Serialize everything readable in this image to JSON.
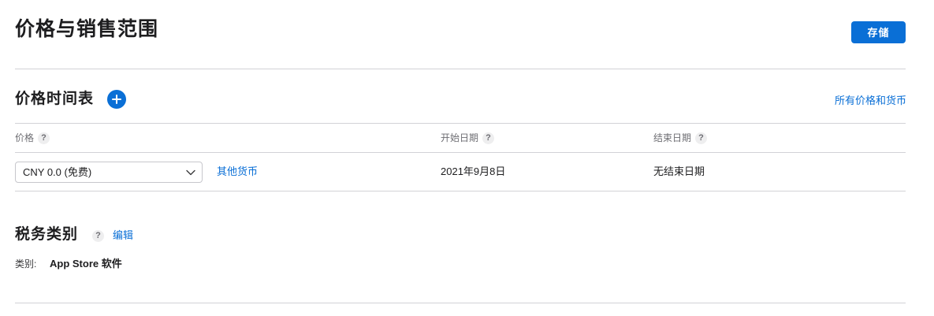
{
  "page": {
    "title": "价格与销售范围",
    "save_label": "存储"
  },
  "price_schedule": {
    "title": "价格时间表",
    "all_prices_link": "所有价格和货币",
    "columns": {
      "price": "价格",
      "start_date": "开始日期",
      "end_date": "结束日期"
    },
    "help_glyph": "?",
    "row": {
      "price_selected": "CNY 0.0 (免费)",
      "other_currencies_link": "其他货币",
      "start_date": "2021年9月8日",
      "end_date": "无结束日期"
    }
  },
  "tax": {
    "title": "税务类别",
    "edit_link": "编辑",
    "category_label": "类别:",
    "category_value": "App Store 软件"
  },
  "colors": {
    "accent": "#0a6fd6",
    "divider": "#d2d2d7"
  }
}
